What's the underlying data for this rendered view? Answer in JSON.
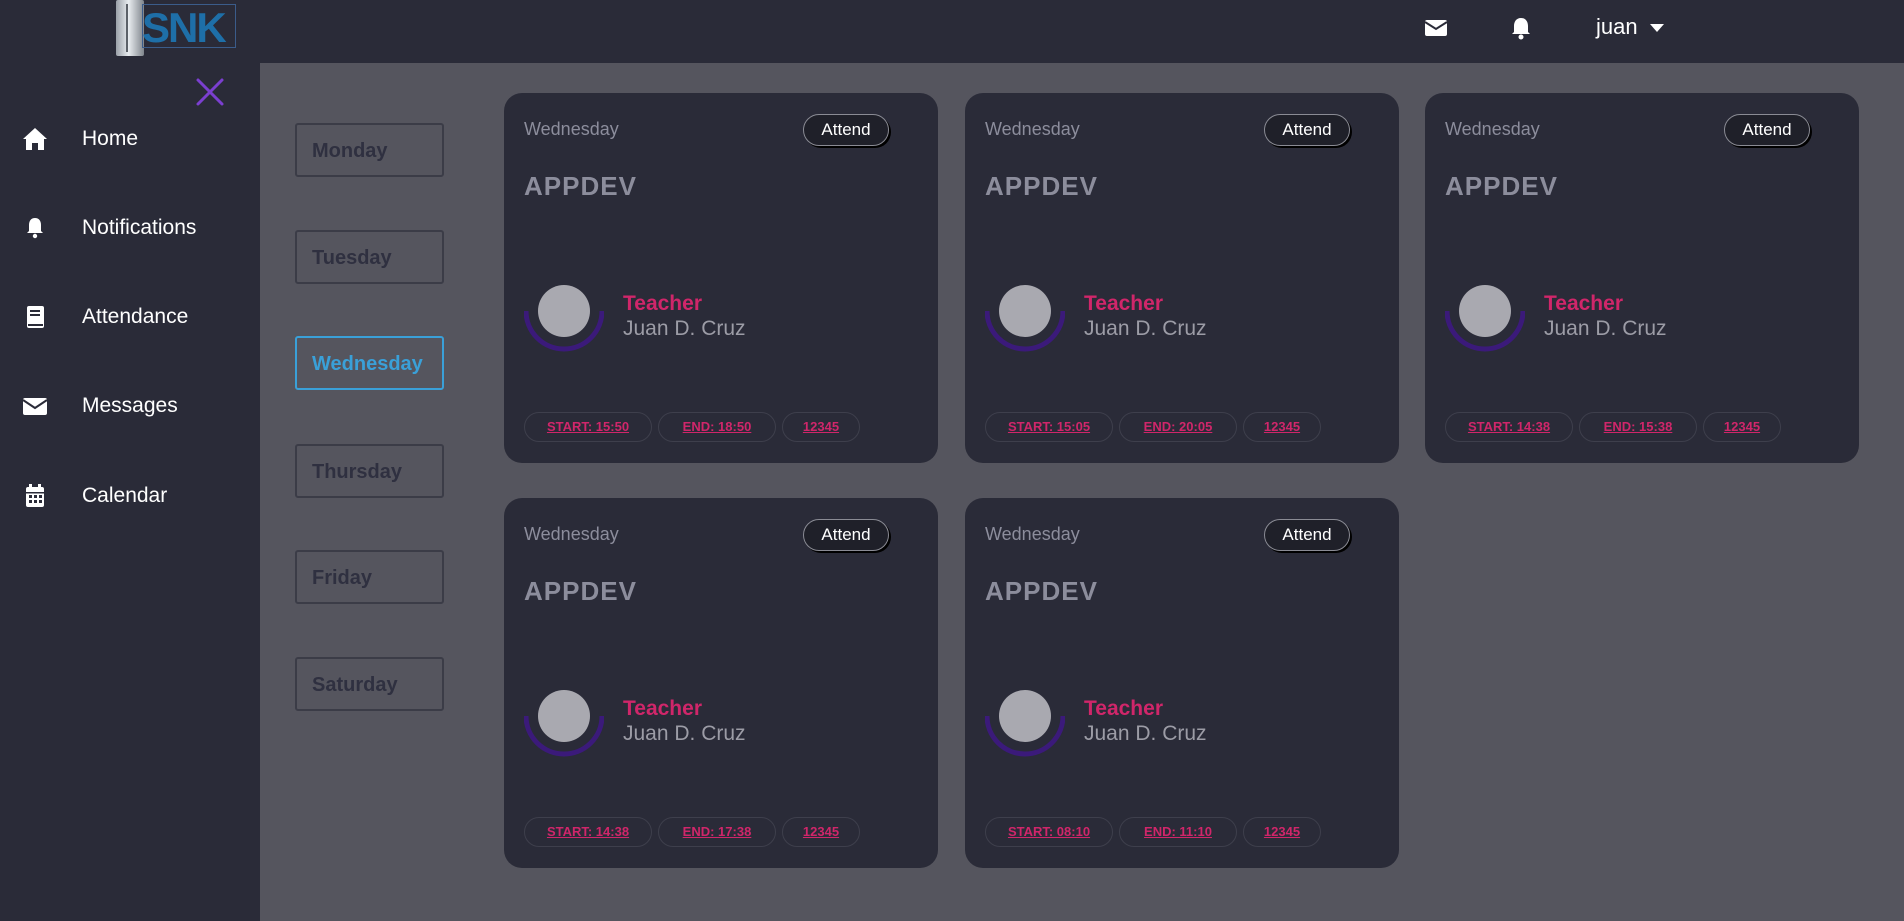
{
  "brand": {
    "logo_text": "SNK"
  },
  "header": {
    "user_name": "juan",
    "icons": [
      "envelope-icon",
      "bell-icon",
      "caret-down-icon"
    ]
  },
  "sidebar": {
    "items": [
      {
        "label": "Home",
        "icon": "home-icon"
      },
      {
        "label": "Notifications",
        "icon": "bell-icon"
      },
      {
        "label": "Attendance",
        "icon": "book-icon"
      },
      {
        "label": "Messages",
        "icon": "envelope-icon"
      },
      {
        "label": "Calendar",
        "icon": "calendar-icon"
      }
    ]
  },
  "days": {
    "selected": "Wednesday",
    "items": [
      "Monday",
      "Tuesday",
      "Wednesday",
      "Thursday",
      "Friday",
      "Saturday"
    ]
  },
  "colors": {
    "accent": "#d0266a",
    "selected_day": "#3aa0d8",
    "close_icon": "#7b3fd0",
    "avatar_ring": "#3b1a7a"
  },
  "classes": [
    {
      "day": "Wednesday",
      "attend_label": "Attend",
      "title": "APPDEV",
      "teacher_label": "Teacher",
      "teacher_name": "Juan D. Cruz",
      "start": "START: 15:50",
      "end": "END: 18:50",
      "code": "12345"
    },
    {
      "day": "Wednesday",
      "attend_label": "Attend",
      "title": "APPDEV",
      "teacher_label": "Teacher",
      "teacher_name": "Juan D. Cruz",
      "start": "START: 15:05",
      "end": "END: 20:05",
      "code": "12345"
    },
    {
      "day": "Wednesday",
      "attend_label": "Attend",
      "title": "APPDEV",
      "teacher_label": "Teacher",
      "teacher_name": "Juan D. Cruz",
      "start": "START: 14:38",
      "end": "END: 15:38",
      "code": "12345"
    },
    {
      "day": "Wednesday",
      "attend_label": "Attend",
      "title": "APPDEV",
      "teacher_label": "Teacher",
      "teacher_name": "Juan D. Cruz",
      "start": "START: 14:38",
      "end": "END: 17:38",
      "code": "12345"
    },
    {
      "day": "Wednesday",
      "attend_label": "Attend",
      "title": "APPDEV",
      "teacher_label": "Teacher",
      "teacher_name": "Juan D. Cruz",
      "start": "START: 08:10",
      "end": "END: 11:10",
      "code": "12345"
    }
  ]
}
